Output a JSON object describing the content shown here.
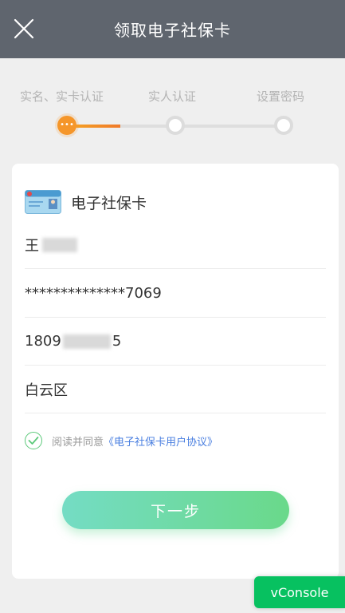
{
  "header": {
    "title": "领取电子社保卡",
    "close_icon": "close-icon"
  },
  "steps": [
    {
      "label": "实名、实卡认证",
      "state": "active",
      "dot_text": "•••"
    },
    {
      "label": "实人认证",
      "state": "pending"
    },
    {
      "label": "设置密码",
      "state": "pending"
    }
  ],
  "card": {
    "title": "电子社保卡",
    "image_icon": "social-security-card-icon",
    "name_prefix": "王",
    "id_number": "**************7069",
    "phone_prefix": "1809",
    "phone_suffix": "5",
    "district": "白云区"
  },
  "agreement": {
    "text": "阅读并同意",
    "link": "《电子社保卡用户协议》",
    "checked": true
  },
  "next_button": "下一步",
  "vconsole_label": "vConsole",
  "colors": {
    "header_bg": "#5f656e",
    "active_step": "#f5962a",
    "link": "#4a7fe0",
    "button_start": "#74dcc4",
    "button_end": "#6ad98a",
    "vconsole_bg": "#07c160"
  }
}
